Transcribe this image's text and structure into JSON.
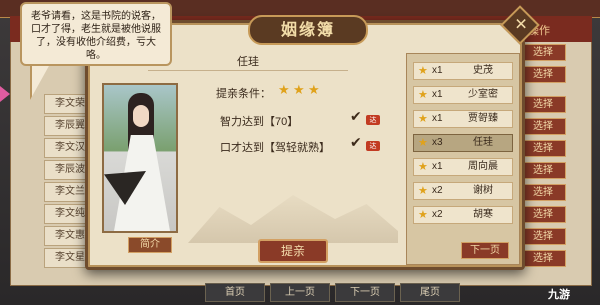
{
  "background": {
    "header_label": "操作",
    "bg_rows": [
      {
        "name": "李文荣",
        "select": "选择"
      },
      {
        "name": "李辰翼",
        "select": "选择"
      },
      {
        "name": "李文汉",
        "select": "选择"
      },
      {
        "name": "李辰波",
        "select": "选择"
      },
      {
        "name": "李文兰",
        "select": "选择"
      },
      {
        "name": "李文纯",
        "select": "选择"
      },
      {
        "name": "李文惠",
        "select": "选择"
      },
      {
        "name": "李文星",
        "select": "选择"
      }
    ],
    "top_select_labels": [
      "选择",
      "选择",
      "选择"
    ],
    "pager": {
      "first": "首页",
      "prev": "上一页",
      "next": "下一页",
      "last": "尾页"
    }
  },
  "speech_bubble": {
    "text": "老爷请看，这是书院的说客，口才了得，老生就是被他说服了，没有收他介绍费，亏大咯。"
  },
  "modal": {
    "title": "姻缘簿",
    "character_name": "任珪",
    "condition_label": "提亲条件：",
    "star_count": 3,
    "requirements": [
      "智力达到【70】",
      "口才达到【驾轻就熟】"
    ],
    "intro_button": "简介",
    "propose_button": "提亲",
    "next_page_button": "下一页",
    "candidates": [
      {
        "qty": "x1",
        "name": "史茂",
        "selected": false
      },
      {
        "qty": "x1",
        "name": "少室密",
        "selected": false
      },
      {
        "qty": "x1",
        "name": "贾哿臻",
        "selected": false
      },
      {
        "qty": "x3",
        "name": "任珪",
        "selected": true
      },
      {
        "qty": "x1",
        "name": "周向晨",
        "selected": false
      },
      {
        "qty": "x2",
        "name": "谢树",
        "selected": false
      },
      {
        "qty": "x2",
        "name": "胡寒",
        "selected": false
      }
    ]
  },
  "watermark": "九游"
}
